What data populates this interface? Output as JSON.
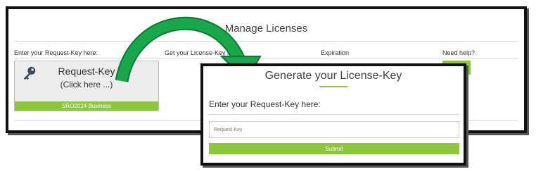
{
  "manage": {
    "title": "Manage Licenses",
    "col_request": "Enter your Request-Key here:",
    "col_license": "Get your License-Key here:",
    "col_expiration": "Expiration",
    "col_help": "Need help?",
    "request_key_button": {
      "title": "Request-Key",
      "subtitle": "(Click here ...)",
      "badge": "SRO2024 Business"
    },
    "key_icon": "key-icon"
  },
  "dialog": {
    "title": "Generate your License-Key",
    "subheading": "Enter your Request-Key here:",
    "input_placeholder": "Request-Key",
    "submit_label": "Submit"
  },
  "colors": {
    "accent": "#8cc63f",
    "arrow": "#1aa64b"
  }
}
